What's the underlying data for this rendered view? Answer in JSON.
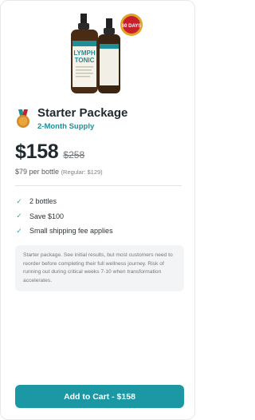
{
  "product": {
    "bottle_label_line1": "LYMPH",
    "bottle_label_line2": "TONIC",
    "badge": "60 DAYS",
    "title": "Starter Package",
    "subtitle": "2-Month Supply",
    "price": "$158",
    "old_price": "$258",
    "per_bottle": "$79 per bottle",
    "regular": "(Regular: $129)",
    "features": [
      {
        "icon": "check-icon",
        "text": "2 bottles"
      },
      {
        "icon": "check-icon",
        "text": "Save $100"
      },
      {
        "icon": "check-icon",
        "text": "Small shipping fee applies"
      }
    ],
    "note": "Starter package. See initial results, but most customers need to reorder before completing their full wellness journey. Risk of running out during critical weeks 7-10 when transformation accelerates.",
    "cta_label": "Add to Cart - $158"
  },
  "colors": {
    "accent": "#1c97a4",
    "subtitle": "#1f8f97",
    "check": "#3aa6a8"
  }
}
